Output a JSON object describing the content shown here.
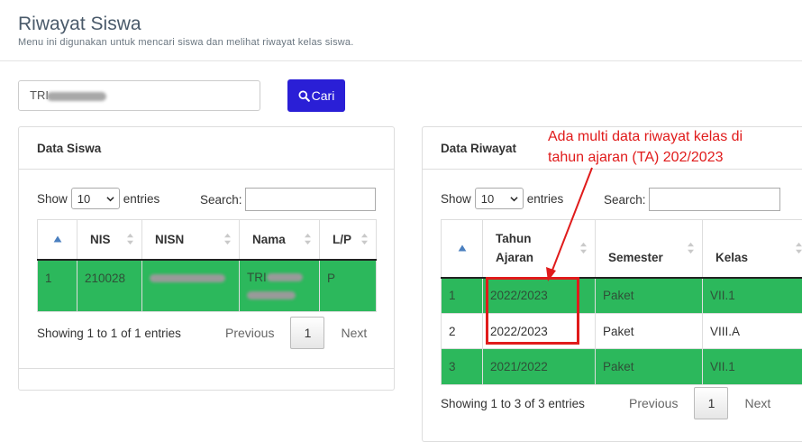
{
  "page": {
    "title": "Riwayat Siswa",
    "subtitle": "Menu ini digunakan untuk mencari siswa dan melihat riwayat kelas siswa."
  },
  "search": {
    "value": "TRI",
    "button_label": "Cari",
    "button_icon": "search-icon"
  },
  "left_panel": {
    "heading": "Data Siswa",
    "show_label": "Show",
    "entries_value": "10",
    "entries_label": "entries",
    "search_label": "Search:",
    "columns": [
      "NIS",
      "NISN",
      "Nama",
      "L/P"
    ],
    "rows": [
      {
        "no": "1",
        "nis": "210028",
        "nama": "TRI",
        "lp": "P"
      }
    ],
    "info": "Showing 1 to 1 of 1 entries",
    "pagination": {
      "previous": "Previous",
      "page": "1",
      "next": "Next"
    }
  },
  "right_panel": {
    "heading": "Data Riwayat",
    "show_label": "Show",
    "entries_value": "10",
    "entries_label": "entries",
    "search_label": "Search:",
    "columns": [
      "Tahun Ajaran",
      "Semester",
      "Kelas"
    ],
    "rows": [
      {
        "no": "1",
        "tahun": "2022/2023",
        "semester": "Paket",
        "kelas": "VII.1"
      },
      {
        "no": "2",
        "tahun": "2022/2023",
        "semester": "Paket",
        "kelas": "VIII.A"
      },
      {
        "no": "3",
        "tahun": "2021/2022",
        "semester": "Paket",
        "kelas": "VII.1"
      }
    ],
    "info": "Showing 1 to 3 of 3 entries",
    "pagination": {
      "previous": "Previous",
      "page": "1",
      "next": "Next"
    }
  },
  "annotation": {
    "text": "Ada multi data riwayat kelas di tahun ajaran (TA) 202/2023",
    "color": "#e01b1b"
  },
  "colors": {
    "row_highlight": "#2cb85c",
    "button": "#2a1fd6"
  }
}
